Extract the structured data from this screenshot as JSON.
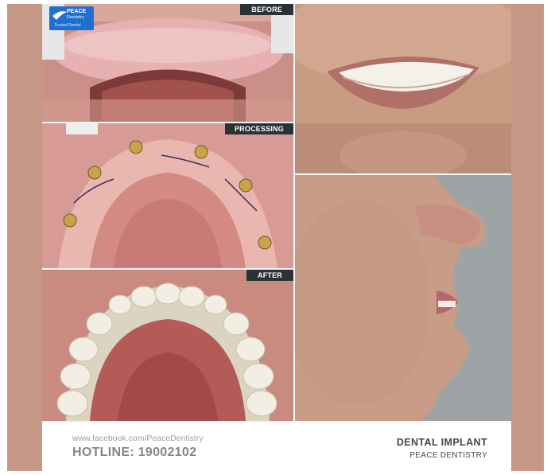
{
  "labels": {
    "before": "BEFORE",
    "processing": "PROCESSING",
    "after": "AFTER"
  },
  "logo": {
    "line1": "PEACE",
    "line2": "Dentistry",
    "line3": "Trusted Dentist"
  },
  "footer": {
    "facebook": "www.facebook.com/PeaceDentistry",
    "hotline": "HOTLINE: 19002102",
    "title": "DENTAL IMPLANT",
    "subtitle": "PEACE DENTISTRY"
  },
  "colors": {
    "rail": "#c59787",
    "tag_bg": "#2b3236",
    "logo_bg": "#1f6fd0"
  }
}
